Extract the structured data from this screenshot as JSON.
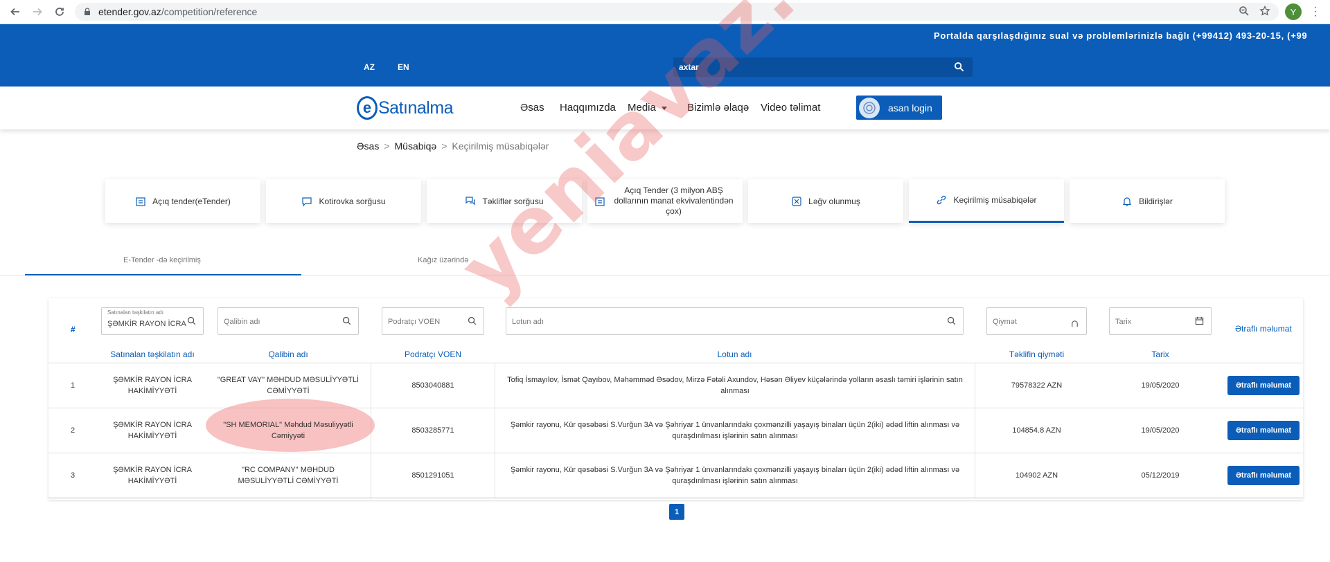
{
  "browser": {
    "url_host": "etender.gov.az",
    "url_path": "/competition/reference",
    "profile_initial": "Y",
    "colors": {
      "profile": "#4e8f3a"
    }
  },
  "header": {
    "ticker": "Portalda qarşılaşdığınız sual və problemlərinizlə bağlı (+99412) 493-20-15, (+99",
    "langs": [
      "AZ",
      "EN"
    ],
    "search_value": "axtar",
    "colors": {
      "brand": "#0b5db8"
    }
  },
  "nav": {
    "logo_text": "Satınalma",
    "logo_letter": "e",
    "items": [
      "Əsas",
      "Haqqımızda",
      "Media",
      "Bizimlə əlaqə",
      "Video təlimat"
    ],
    "login_label": "asan login"
  },
  "breadcrumb": {
    "items": [
      "Əsas",
      "Müsabiqə",
      "Keçirilmiş müsabiqələr"
    ],
    "separator": ">"
  },
  "tiles": [
    {
      "label": "Açıq tender(eTender)",
      "icon": "tender-icon"
    },
    {
      "label": "Kotirovka sorğusu",
      "icon": "chat-icon"
    },
    {
      "label": "Təkliflər sorğusu",
      "icon": "chat-bubbles-icon"
    },
    {
      "label": "Açıq Tender (3 milyon ABŞ dollarının manat ekvivalentindən çox)",
      "icon": "tender-icon"
    },
    {
      "label": "Ləğv olunmuş",
      "icon": "cancel-icon"
    },
    {
      "label": "Keçirilmiş müsabiqələr",
      "icon": "link-icon",
      "active": true
    },
    {
      "label": "Bildirişlər",
      "icon": "bell-icon"
    }
  ],
  "subtabs": [
    "E-Tender -də keçirilmiş",
    "Kağız üzərində"
  ],
  "filters": {
    "org_label": "Satınalan təşkilatın adı",
    "org_value": "ŞƏMKİR RAYON İCRA",
    "company_placeholder": "Qalibin adı",
    "voen_placeholder": "Podratçı VOEN",
    "lot_placeholder": "Lotun adı",
    "price_placeholder": "Qiymət",
    "date_placeholder": "Tarix",
    "detail_link": "Ətraflı məlumat"
  },
  "table": {
    "hash": "#",
    "columns": [
      "Satınalan təşkilatın adı",
      "Qalibin adı",
      "Podratçı VOEN",
      "Lotun adı",
      "Təklifin qiyməti",
      "Tarix"
    ],
    "rows": [
      {
        "n": "1",
        "org": "ŞƏMKİR RAYON İCRA HAKİMİYYƏTİ",
        "winner": "\"GREAT VAY\" MƏHDUD MƏSULİYYƏTLİ CƏMİYYƏTİ",
        "voen": "8503040881",
        "lot": "Tofiq İsmayılov, İsmət Qayıbov, Məhəmməd Əsədov, Mirzə Fətəli Axundov, Həsən Əliyev küçələrində yolların əsaslı təmiri işlərinin satın alınması",
        "price": "79578322 AZN",
        "date": "19/05/2020",
        "button": "Ətraflı məlumat"
      },
      {
        "n": "2",
        "org": "ŞƏMKİR RAYON İCRA HAKİMİYYƏTİ",
        "winner": "\"SH MEMORIAL\" Məhdud Məsuliyyətli Cəmiyyəti",
        "voen": "8503285771",
        "lot": "Şəmkir rayonu, Kür qəsəbəsi S.Vurğun 3A və Şəhriyar 1 ünvanlarındakı çoxmənzilli yaşayış binaları üçün 2(iki) ədəd liftin alınması və quraşdırılması işlərinin satın alınması",
        "price": "104854.8 AZN",
        "date": "19/05/2020",
        "button": "Ətraflı məlumat"
      },
      {
        "n": "3",
        "org": "ŞƏMKİR RAYON İCRA HAKİMİYYƏTİ",
        "winner": "\"RC COMPANY\" MƏHDUD MƏSULİYYƏTLİ CƏMİYYƏTİ",
        "voen": "8501291051",
        "lot": "Şəmkir rayonu, Kür qəsəbəsi S.Vurğun 3A və Şəhriyar 1 ünvanlarındakı çoxmənzilli yaşayış binaları üçün 2(iki) ədəd liftin alınması və quraşdırılması işlərinin satın alınması",
        "price": "104902 AZN",
        "date": "05/12/2019",
        "button": "Ətraflı məlumat"
      }
    ]
  },
  "pagination": {
    "current": "1"
  },
  "watermark": "yeniavaz.com"
}
